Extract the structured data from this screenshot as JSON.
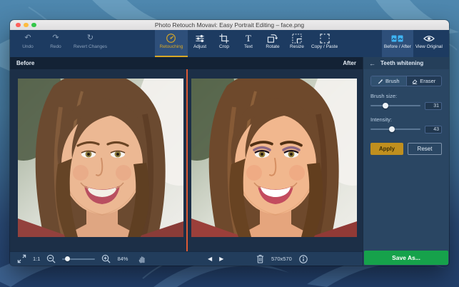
{
  "window": {
    "title": "Photo Retouch Movavi: Easy Portrait Editing – face.png"
  },
  "toolbar": {
    "undo": "Undo",
    "redo": "Redo",
    "revert": "Revert Changes",
    "tabs": [
      {
        "label": "Retouching",
        "active": true
      },
      {
        "label": "Adjust"
      },
      {
        "label": "Crop"
      },
      {
        "label": "Text"
      },
      {
        "label": "Rotate"
      },
      {
        "label": "Resize"
      },
      {
        "label": "Copy / Paste"
      }
    ],
    "before_after": "Before / After",
    "view_original": "View Original"
  },
  "compare": {
    "before_label": "Before",
    "after_label": "After"
  },
  "panel": {
    "title": "Teeth whitening",
    "brush": "Brush",
    "eraser": "Eraser",
    "brush_size_label": "Brush size:",
    "brush_size_value": "31",
    "intensity_label": "Intensity:",
    "intensity_value": "43",
    "apply": "Apply",
    "reset": "Reset",
    "save_as": "Save As..."
  },
  "statusbar": {
    "ratio": "1:1",
    "zoom_level": "84%",
    "dimensions": "570x570"
  },
  "icons": {
    "undo": "↶",
    "redo": "↷",
    "revert": "↻",
    "back": "←",
    "prev": "◀",
    "next": "▶",
    "text_tool": "T"
  },
  "colors": {
    "accent_gold": "#d9a826",
    "accent_blue": "#3fb3f2",
    "accent_green": "#16a24b",
    "divider_orange": "#dd5a35",
    "apply_gold": "#c08f1e"
  }
}
